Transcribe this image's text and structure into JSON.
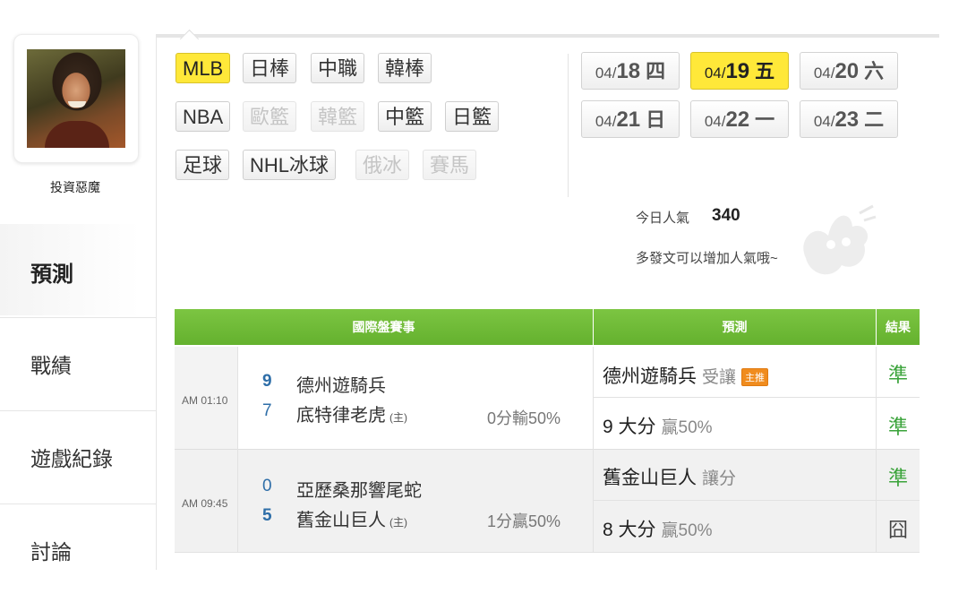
{
  "user": {
    "name": "投資惡魔"
  },
  "nav": {
    "predict": "預測",
    "record": "戰績",
    "history": "遊戲紀錄",
    "discuss": "討論"
  },
  "sports": [
    {
      "label": "MLB",
      "state": "active"
    },
    {
      "label": "日棒",
      "state": "normal"
    },
    {
      "label": "中職",
      "state": "normal"
    },
    {
      "label": "韓棒",
      "state": "normal"
    },
    {
      "label": "NBA",
      "state": "normal"
    },
    {
      "label": "歐籃",
      "state": "disabled"
    },
    {
      "label": "韓籃",
      "state": "disabled"
    },
    {
      "label": "中籃",
      "state": "normal"
    },
    {
      "label": "日籃",
      "state": "normal"
    },
    {
      "label": "足球",
      "state": "normal"
    },
    {
      "label": "NHL冰球",
      "state": "normal"
    },
    {
      "label": "俄冰",
      "state": "disabled"
    },
    {
      "label": "賽馬",
      "state": "disabled"
    }
  ],
  "dates": [
    {
      "md": "04/",
      "dd": "18",
      "wd": "四",
      "active": false
    },
    {
      "md": "04/",
      "dd": "19",
      "wd": "五",
      "active": true
    },
    {
      "md": "04/",
      "dd": "20",
      "wd": "六",
      "active": false
    },
    {
      "md": "04/",
      "dd": "21",
      "wd": "日",
      "active": false
    },
    {
      "md": "04/",
      "dd": "22",
      "wd": "一",
      "active": false
    },
    {
      "md": "04/",
      "dd": "23",
      "wd": "二",
      "active": false
    }
  ],
  "popularity": {
    "label": "今日人氣",
    "value": "340",
    "hint": "多發文可以增加人氣哦~"
  },
  "table": {
    "headers": {
      "event": "國際盤賽事",
      "prediction": "預測",
      "result": "結果"
    },
    "games": [
      {
        "time": "AM 01:10",
        "away_score": "9",
        "away_team": "德州遊騎兵",
        "home_score": "7",
        "home_team": "底特律老虎",
        "home_tag": "(主)",
        "line": "0分輸50%",
        "pred1_main": "德州遊騎兵",
        "pred1_sub": "受讓",
        "pred1_badge": "主推",
        "pred1_result": "準",
        "pred2_main": "9 大分",
        "pred2_sub": "贏50%",
        "pred2_result": "準"
      },
      {
        "time": "AM 09:45",
        "away_score": "0",
        "away_team": "亞歷桑那響尾蛇",
        "home_score": "5",
        "home_team": "舊金山巨人",
        "home_tag": "(主)",
        "line": "1分贏50%",
        "pred1_main": "舊金山巨人",
        "pred1_sub": "讓分",
        "pred1_badge": "",
        "pred1_result": "準",
        "pred2_main": "8 大分",
        "pred2_sub": "贏50%",
        "pred2_result": "囧"
      }
    ]
  }
}
